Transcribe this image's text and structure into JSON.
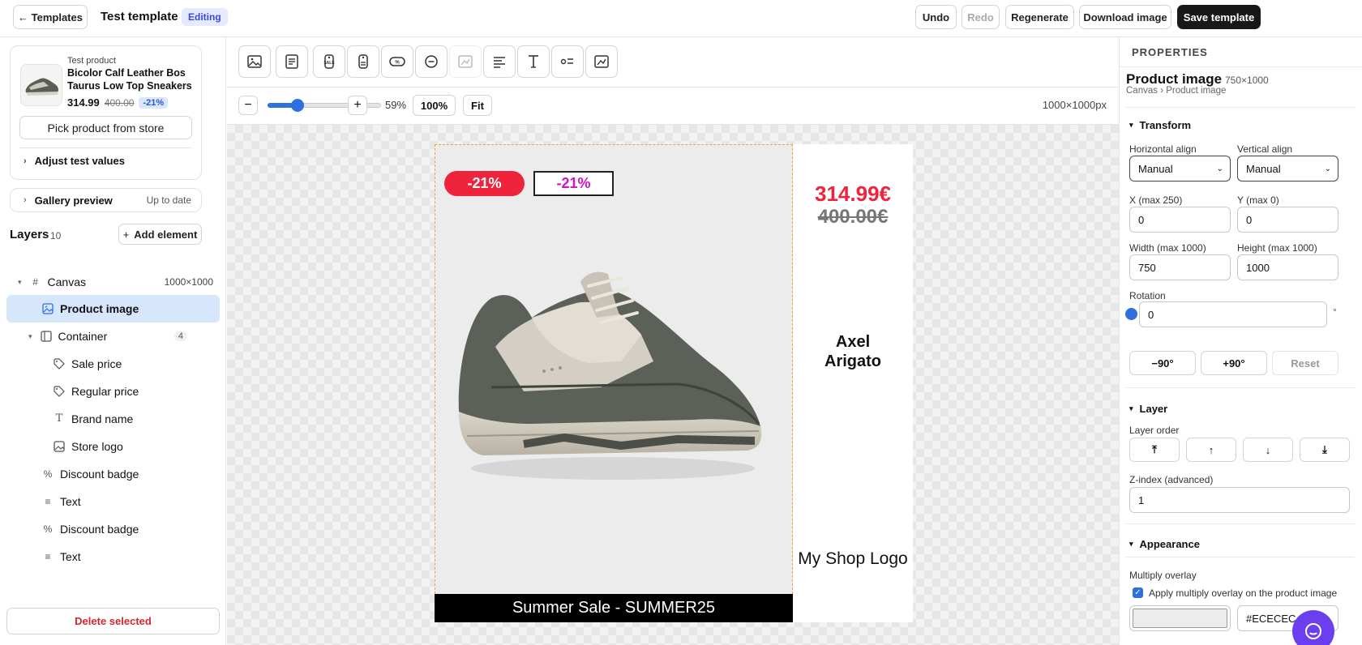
{
  "topbar": {
    "back_label": "← Templates",
    "title": "Test template",
    "status_badge": "Editing",
    "undo": "Undo",
    "redo": "Redo",
    "regenerate": "Regenerate",
    "download": "Download image",
    "save": "Save template"
  },
  "product_card": {
    "caption": "Test product",
    "name": "Bicolor Calf Leather Bos Taurus Low Top Sneakers",
    "price": "314.99",
    "old_price": "400.00",
    "discount": "-21%",
    "pick_button": "Pick product from store",
    "adjust": "Adjust test values"
  },
  "gallery": {
    "label": "Gallery preview",
    "status": "Up to date"
  },
  "layers": {
    "title": "Layers",
    "count": "10",
    "add_button": "Add element",
    "canvas": {
      "label": "Canvas",
      "size": "1000×1000"
    },
    "items": [
      {
        "label": "Product image",
        "icon": "image-icon"
      },
      {
        "label": "Container",
        "icon": "container-icon",
        "count": "4"
      },
      {
        "label": "Sale price",
        "icon": "tag-icon"
      },
      {
        "label": "Regular price",
        "icon": "tag-icon"
      },
      {
        "label": "Brand name",
        "icon": "text-icon"
      },
      {
        "label": "Store logo",
        "icon": "image-icon"
      },
      {
        "label": "Discount badge",
        "icon": "percent-icon"
      },
      {
        "label": "Text",
        "icon": "lines-icon"
      },
      {
        "label": "Discount badge",
        "icon": "percent-icon"
      },
      {
        "label": "Text",
        "icon": "lines-icon"
      }
    ],
    "delete": "Delete selected"
  },
  "zoom": {
    "minus": "−",
    "plus": "+",
    "level": "59%",
    "level_fraction": 0.59,
    "full": "100%",
    "fit": "Fit",
    "size": "1000×1000px"
  },
  "preview": {
    "badge_filled": "-21%",
    "badge_outline": "-21%",
    "sale_price": "314.99€",
    "regular_price": "400.00€",
    "brand": "Axel Arigato",
    "logo": "My Shop Logo",
    "banner": "Summer Sale - SUMMER25",
    "colors": {
      "sale": "#ef233c",
      "badge_outline_text": "#d014c9",
      "banner_bg": "#000000",
      "image_bg": "#ececec"
    }
  },
  "properties": {
    "header": "PROPERTIES",
    "element": "Product image",
    "element_size": "750×1000",
    "breadcrumb": "Canvas › Product image",
    "transform": {
      "title": "Transform",
      "h_align_label": "Horizontal align",
      "h_align": "Manual",
      "v_align_label": "Vertical align",
      "v_align": "Manual",
      "x_label": "X (max 250)",
      "x": "0",
      "y_label": "Y (max 0)",
      "y": "0",
      "w_label": "Width (max 1000)",
      "w": "750",
      "h_label": "Height (max 1000)",
      "h": "1000",
      "rotation_label": "Rotation",
      "rotation": "0",
      "degree": "°",
      "minus90": "−90°",
      "plus90": "+90°",
      "reset": "Reset"
    },
    "layer": {
      "title": "Layer",
      "order_label": "Layer order",
      "z_label": "Z-index (advanced)",
      "z": "1"
    },
    "appearance": {
      "title": "Appearance",
      "overlay_label": "Multiply overlay",
      "overlay_check": "Apply multiply overlay on the product image",
      "overlay_checked": true,
      "color": "#ECECEC"
    }
  }
}
